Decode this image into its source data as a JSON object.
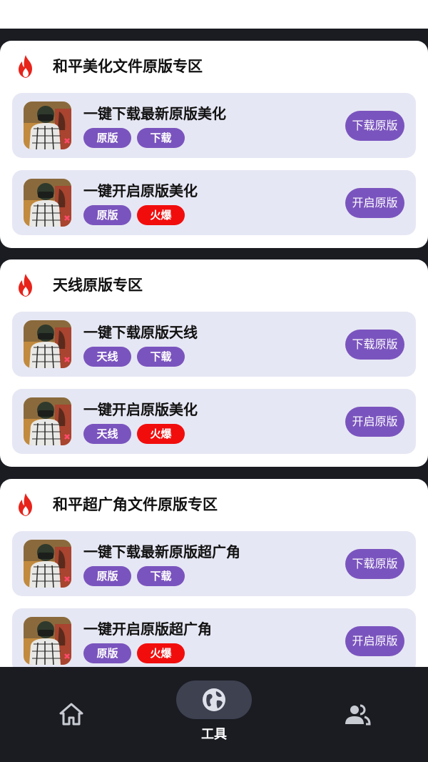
{
  "sections": [
    {
      "title": "和平美化文件原版专区",
      "items": [
        {
          "title": "一键下载最新原版美化",
          "tags": [
            "原版",
            "下载"
          ],
          "hot": [
            false,
            false
          ],
          "action": "下载原版"
        },
        {
          "title": "一键开启原版美化",
          "tags": [
            "原版",
            "火爆"
          ],
          "hot": [
            false,
            true
          ],
          "action": "开启原版"
        }
      ]
    },
    {
      "title": "天线原版专区",
      "items": [
        {
          "title": "一键下载原版天线",
          "tags": [
            "天线",
            "下载"
          ],
          "hot": [
            false,
            false
          ],
          "action": "下载原版"
        },
        {
          "title": "一键开启原版美化",
          "tags": [
            "天线",
            "火爆"
          ],
          "hot": [
            false,
            true
          ],
          "action": "开启原版"
        }
      ]
    },
    {
      "title": "和平超广角文件原版专区",
      "items": [
        {
          "title": "一键下载最新原版超广角",
          "tags": [
            "原版",
            "下载"
          ],
          "hot": [
            false,
            false
          ],
          "action": "下载原版"
        },
        {
          "title": "一键开启原版超广角",
          "tags": [
            "原版",
            "火爆"
          ],
          "hot": [
            false,
            true
          ],
          "action": "开启原版"
        }
      ]
    }
  ],
  "bottom_nav": {
    "home_icon": "home-icon",
    "tools_icon": "globe-icon",
    "tools_label": "工具",
    "user_icon": "users-icon"
  },
  "colors": {
    "accent": "#7a54be",
    "hot": "#f20d0d",
    "item_bg": "#e6e7f4",
    "nav_bg": "#1a1c22"
  }
}
